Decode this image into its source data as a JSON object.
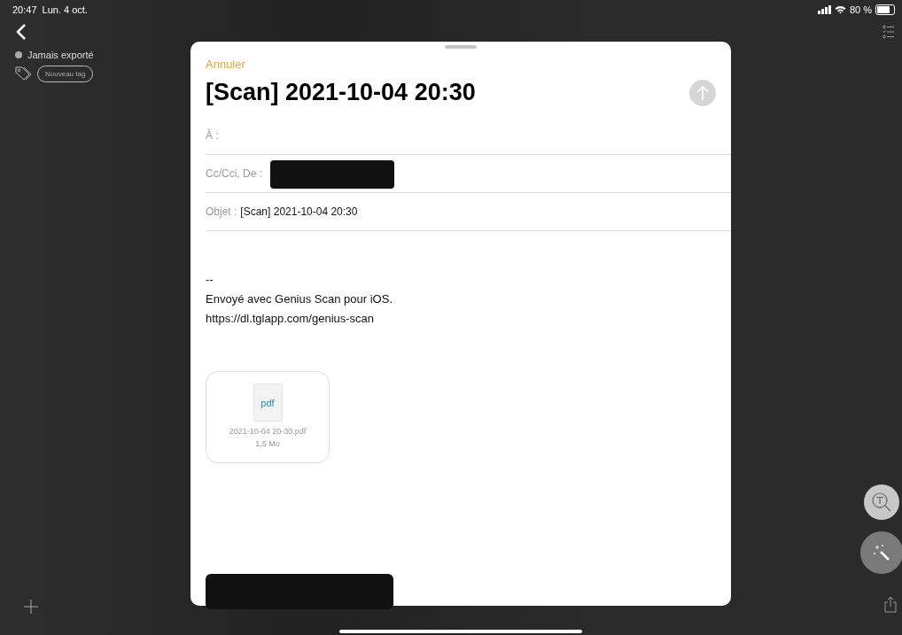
{
  "status_bar": {
    "time": "20:47",
    "date": "Lun. 4 oct.",
    "battery": "80 %"
  },
  "background": {
    "export_status": "Jamais exporté",
    "tag_button": "Nouveau tag"
  },
  "mail_sheet": {
    "cancel": "Annuler",
    "subject_title": "[Scan] 2021-10-04 20:30",
    "send_disabled": true,
    "fields": [
      {
        "label": "À :"
      },
      {
        "label": "Cc/Cci, De :",
        "redacted": true
      },
      {
        "label": "Objet :",
        "value": "[Scan] 2021-10-04 20:30"
      }
    ],
    "body": [
      "--",
      "Envoyé avec Genius Scan pour iOS.",
      "https://dl.tglapp.com/genius-scan"
    ],
    "attachment": {
      "type": "pdf",
      "name": "2021-10-04 20-30.pdf",
      "size": "1,5 Mo"
    }
  }
}
